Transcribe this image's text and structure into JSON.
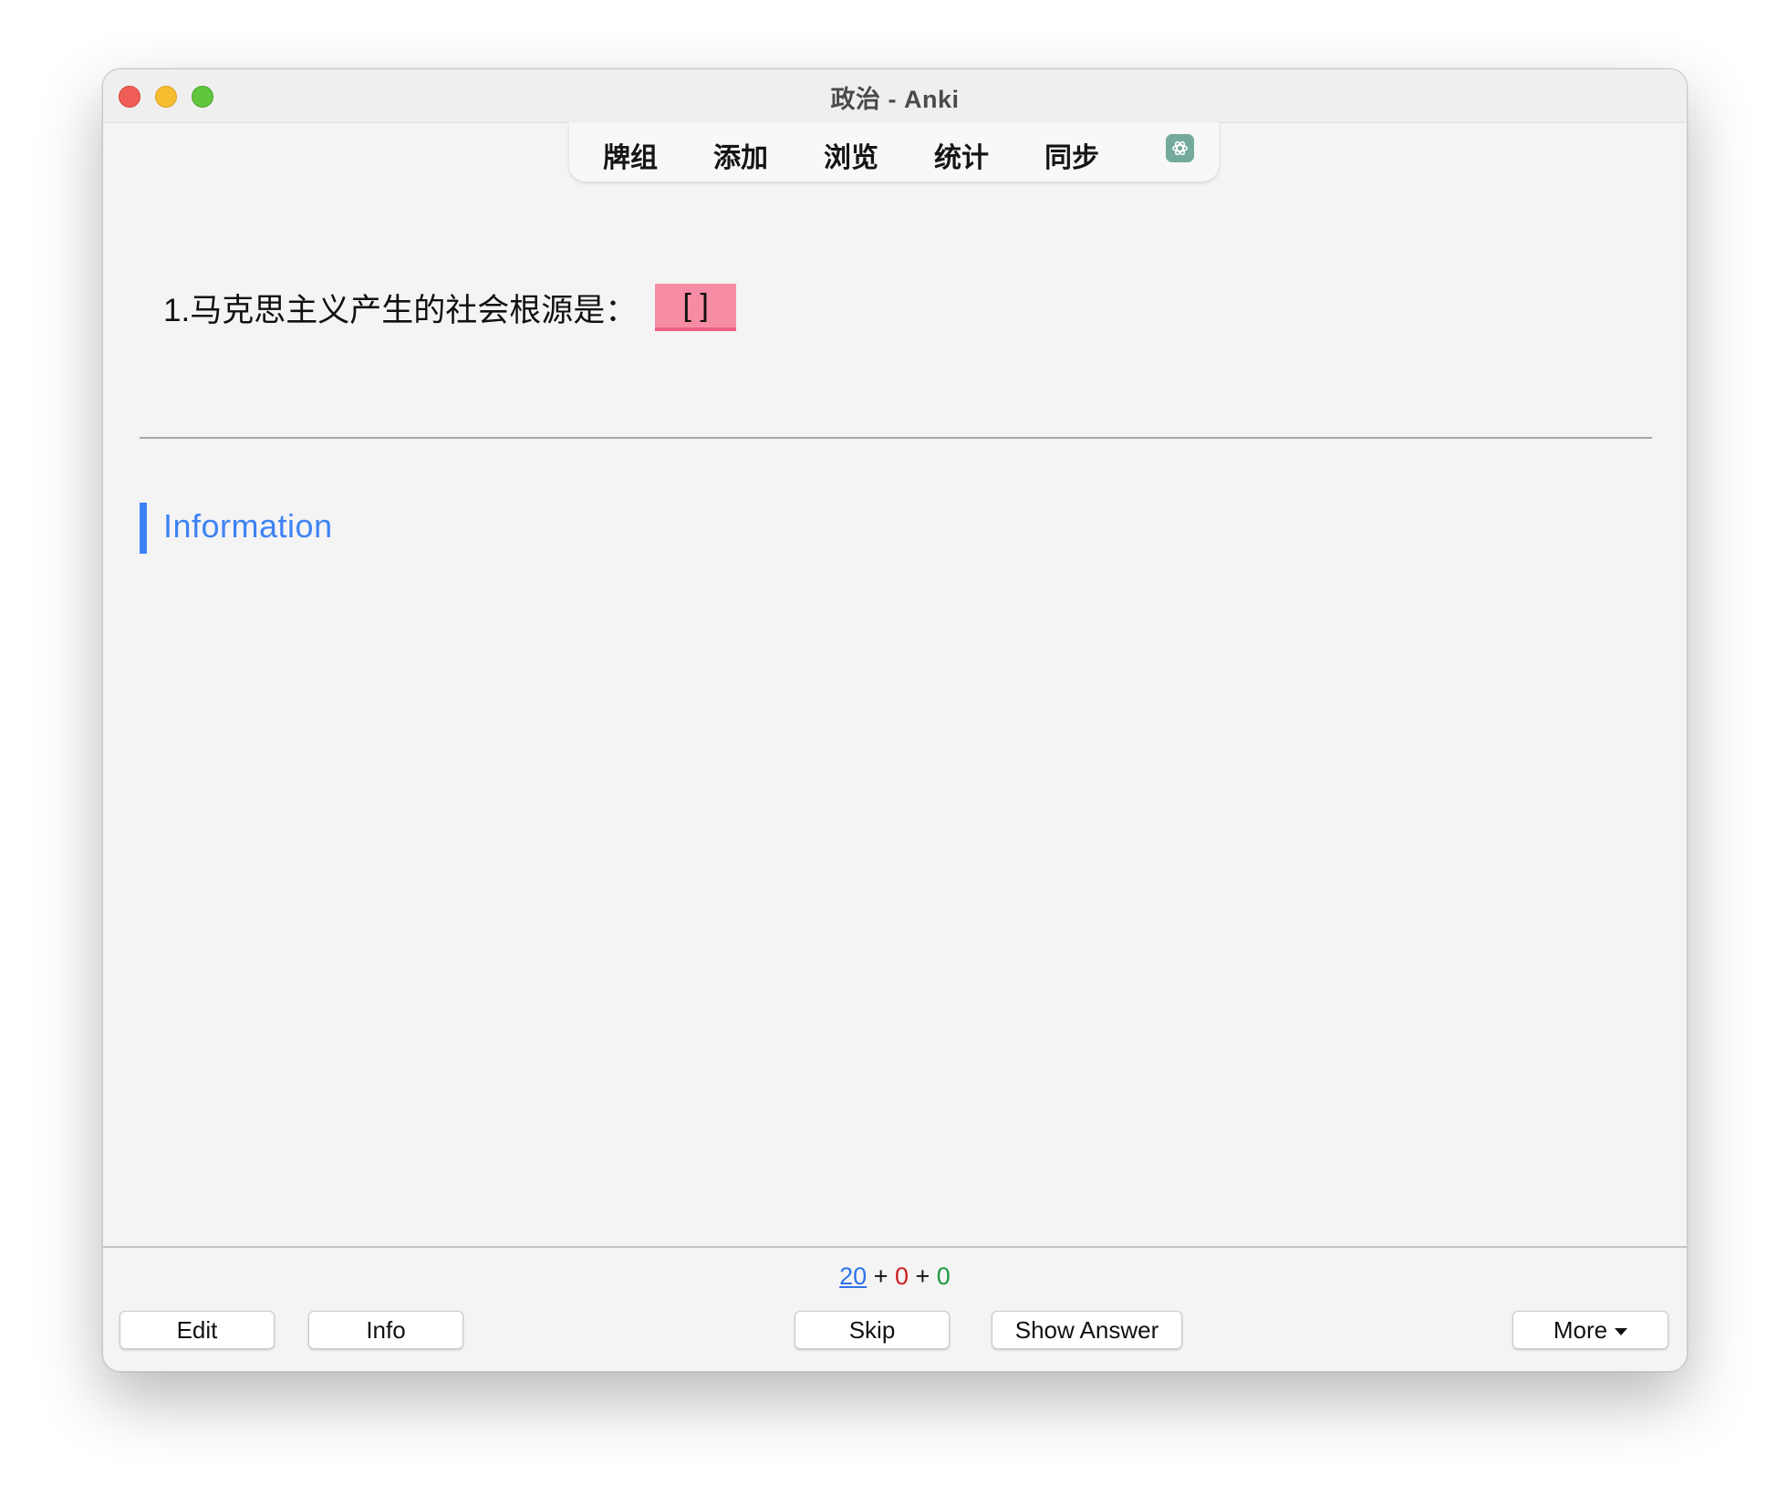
{
  "window": {
    "title": "政治 - Anki"
  },
  "toolbar": {
    "items": [
      {
        "label": "牌组"
      },
      {
        "label": "添加"
      },
      {
        "label": "浏览"
      },
      {
        "label": "统计"
      },
      {
        "label": "同步"
      }
    ],
    "ai_icon": "openai-icon"
  },
  "card": {
    "question": "1.马克思主义产生的社会根源是：",
    "cloze": "[    ]",
    "section_heading": "Information"
  },
  "counts": {
    "new": "20",
    "learning": "0",
    "review": "0",
    "separator": " + "
  },
  "buttons": {
    "edit": "Edit",
    "info": "Info",
    "skip": "Skip",
    "show_answer": "Show Answer",
    "more": "More"
  },
  "colors": {
    "accent": "#3e83f5",
    "cloze_bg": "#f78da4",
    "learning": "#d21f1f",
    "review": "#1a9a3e"
  }
}
